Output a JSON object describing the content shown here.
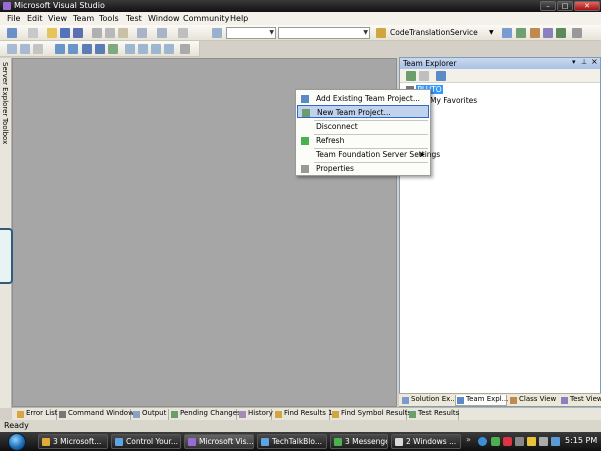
{
  "window": {
    "title": "Microsoft Visual Studio",
    "controls": [
      "–",
      "□",
      "✕"
    ]
  },
  "menu": [
    "File",
    "Edit",
    "View",
    "Team",
    "Tools",
    "Test",
    "Window",
    "Community",
    "Help"
  ],
  "toolbar": {
    "startup_project": "CodeTranslationService",
    "config_value": "",
    "platform_value": ""
  },
  "left_tabs": [
    "Server Explorer",
    "Toolbox"
  ],
  "team_explorer": {
    "title": "Team Explorer",
    "nodes": [
      {
        "label": "PLUTO",
        "selected": true
      },
      {
        "label": "My Favorites"
      }
    ]
  },
  "context_menu": {
    "items": [
      {
        "label": "Add Existing Team Project...",
        "highlighted": false,
        "submenu": false,
        "icon": "add-project-icon"
      },
      {
        "label": "New Team Project...",
        "highlighted": true,
        "submenu": false,
        "icon": "new-project-icon"
      },
      {
        "label": "Disconnect",
        "highlighted": false,
        "submenu": false,
        "icon": ""
      },
      {
        "label": "Refresh",
        "highlighted": false,
        "submenu": false,
        "icon": "refresh-icon"
      },
      {
        "label": "Team Foundation Server Settings",
        "highlighted": false,
        "submenu": true,
        "icon": ""
      },
      {
        "label": "Properties",
        "highlighted": false,
        "submenu": false,
        "icon": "properties-icon"
      }
    ]
  },
  "right_tabs": [
    {
      "label": "Solution Ex...",
      "active": false
    },
    {
      "label": "Team Expl...",
      "active": true
    },
    {
      "label": "Class View",
      "active": false
    },
    {
      "label": "Test View",
      "active": false
    }
  ],
  "lower_tabs": [
    "Error List",
    "Command Window",
    "Output",
    "Pending Changes",
    "History",
    "Find Results 1",
    "Find Symbol Results",
    "Test Results"
  ],
  "status": "Ready",
  "taskbar": {
    "items": [
      {
        "label": "3 Microsoft...",
        "active": false
      },
      {
        "label": "Control Your...",
        "active": false
      },
      {
        "label": "Microsoft Vis...",
        "active": true
      },
      {
        "label": "TechTalkBlo...",
        "active": false
      },
      {
        "label": "3 Messenger",
        "active": false
      },
      {
        "label": "2 Windows ...",
        "active": false
      }
    ],
    "clock": "5:15 PM"
  },
  "colors": {
    "highlight": "#c1d2ee",
    "selection": "#3399ff",
    "doc_background": "#a6a6a6"
  }
}
